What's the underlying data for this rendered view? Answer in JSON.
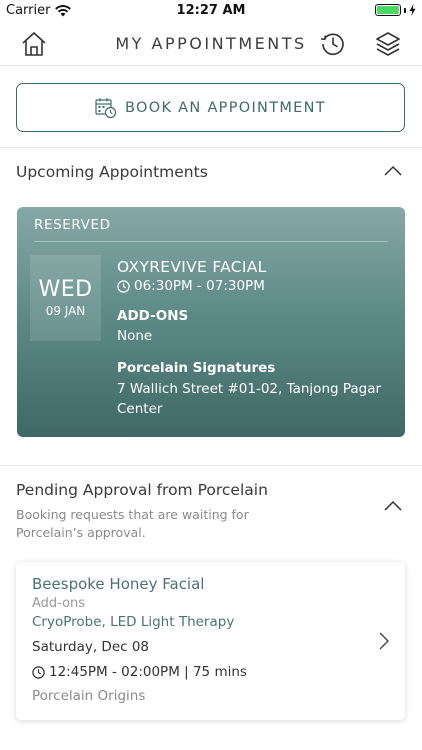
{
  "status_bar": {
    "carrier": "Carrier",
    "time": "12:27 AM",
    "battery_level": 1.0,
    "battery_color": "#4cd964"
  },
  "nav": {
    "title": "MY APPOINTMENTS",
    "left_icon": "home-icon",
    "right_icons": [
      "history-icon",
      "layers-icon"
    ]
  },
  "book_button": {
    "label": "BOOK AN APPOINTMENT",
    "icon": "calendar-clock-icon"
  },
  "upcoming": {
    "title": "Upcoming Appointments",
    "expanded": true,
    "card": {
      "status": "RESERVED",
      "day": "WED",
      "date": "09 JAN",
      "treatment": "OXYREVIVE FACIAL",
      "time": "06:30PM - 07:30PM",
      "addons_label": "ADD-ONS",
      "addons_value": "None",
      "venue": "Porcelain Signatures",
      "address": "7 Wallich Street #01-02, Tanjong Pagar Center"
    }
  },
  "pending": {
    "title": "Pending Approval from Porcelain",
    "subtitle": "Booking requests that are waiting for Porcelain’s approval.",
    "expanded": true,
    "card": {
      "treatment": "Beespoke Honey Facial",
      "addons_label": "Add-ons",
      "addons": "CryoProbe, LED Light Therapy",
      "date": "Saturday, Dec 08",
      "time": "12:45PM - 02:00PM | 75 mins",
      "venue": "Porcelain Origins"
    }
  },
  "colors": {
    "accent": "#3f6b6a",
    "card_top": "#86a8a6",
    "card_bottom": "#3f6866",
    "link_text": "#4a7473"
  }
}
